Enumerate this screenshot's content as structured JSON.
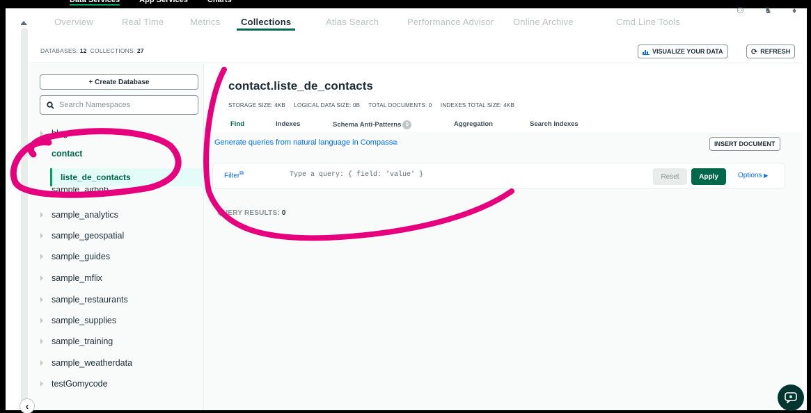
{
  "topnav": {
    "items": [
      "Data Services",
      "App Services",
      "Charts"
    ]
  },
  "tabs": [
    "Overview",
    "Real Time",
    "Metrics",
    "Collections",
    "Atlas Search",
    "Performance Advisor",
    "Online Archive",
    "Cmd Line Tools"
  ],
  "counts": {
    "databases_label": "DATABASES:",
    "databases_value": "12",
    "collections_label": "COLLECTIONS:",
    "collections_value": "27"
  },
  "toolbar": {
    "visualize_label": "VISUALIZE YOUR DATA",
    "refresh_label": "REFRESH"
  },
  "sidebar": {
    "create_database_label": "+ Create Database",
    "search_placeholder": "Search Namespaces",
    "databases": [
      "blog",
      "contact",
      "sample_airbnb",
      "sample_analytics",
      "sample_geospatial",
      "sample_guides",
      "sample_mflix",
      "sample_restaurants",
      "sample_supplies",
      "sample_training",
      "sample_weatherdata",
      "testGomycode"
    ],
    "selected_collection": "liste_de_contacts"
  },
  "collection": {
    "title": "contact.liste_de_contacts",
    "stats": [
      "STORAGE SIZE: 4KB",
      "LOGICAL DATA SIZE: 0B",
      "TOTAL DOCUMENTS: 0",
      "INDEXES TOTAL SIZE: 4KB"
    ],
    "subtabs": [
      "Find",
      "Indexes",
      "Schema Anti-Patterns",
      "Aggregation",
      "Search Indexes"
    ],
    "schema_badge": "0"
  },
  "query": {
    "compass_link": "Generate queries from natural language in Compass",
    "insert_label": "INSERT DOCUMENT",
    "filter_label": "Filter",
    "filter_placeholder": "Type a query: { field: 'value' }",
    "reset_label": "Reset",
    "apply_label": "Apply",
    "options_label": "Options",
    "results_label": "QUERY RESULTS:",
    "results_value": "0"
  },
  "colors": {
    "accent": "#00684a",
    "link": "#016bf8",
    "annotation": "#e6007e"
  }
}
